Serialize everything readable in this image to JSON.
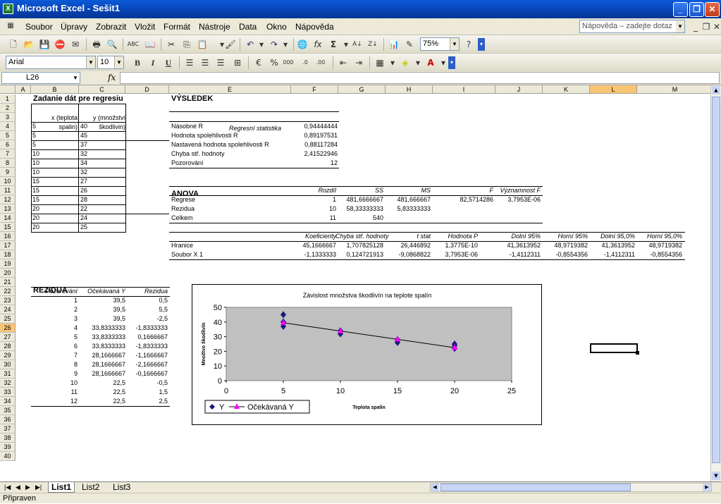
{
  "window": {
    "title": "Microsoft Excel - Sešit1"
  },
  "menu": {
    "items": [
      "Soubor",
      "Úpravy",
      "Zobrazit",
      "Vložit",
      "Formát",
      "Nástroje",
      "Data",
      "Okno",
      "Nápověda"
    ],
    "help_placeholder": "Nápověda – zadejte dotaz"
  },
  "toolbar": {
    "zoom": "75%",
    "font": "Arial",
    "size": "10",
    "bold": "B",
    "italic": "I",
    "underline": "U"
  },
  "formula_bar": {
    "name_box": "L26",
    "fx": "fx",
    "formula": ""
  },
  "columns": [
    "A",
    "B",
    "C",
    "D",
    "E",
    "F",
    "G",
    "H",
    "I",
    "J",
    "K",
    "L",
    "M"
  ],
  "rows": [
    "1",
    "2",
    "3",
    "4",
    "5",
    "6",
    "7",
    "8",
    "9",
    "10",
    "11",
    "12",
    "13",
    "14",
    "15",
    "16",
    "17",
    "18",
    "19",
    "20",
    "21",
    "22",
    "23",
    "24",
    "25",
    "26",
    "27",
    "28",
    "29",
    "30",
    "31",
    "32",
    "33",
    "34",
    "35",
    "36",
    "37",
    "38",
    "39",
    "40"
  ],
  "input_table": {
    "title": "Zadanie dát pre regresiu",
    "hdr_x1": "x (teplota",
    "hdr_x2": "spalin)",
    "hdr_y1": "y (množství",
    "hdr_y2": "škodlivin)",
    "rows": [
      [
        "5",
        "40"
      ],
      [
        "5",
        "45"
      ],
      [
        "5",
        "37"
      ],
      [
        "10",
        "32"
      ],
      [
        "10",
        "34"
      ],
      [
        "10",
        "32"
      ],
      [
        "15",
        "27"
      ],
      [
        "15",
        "26"
      ],
      [
        "15",
        "28"
      ],
      [
        "20",
        "22"
      ],
      [
        "20",
        "24"
      ],
      [
        "20",
        "25"
      ]
    ]
  },
  "summary": {
    "title": "VÝSLEDEK",
    "regress_header": "Regresní statistika",
    "stats": [
      [
        "Násobné R",
        "0,94444444"
      ],
      [
        "Hodnota spolehlivosti R",
        "0,89197531"
      ],
      [
        "Nastavená hodnota spolehlivosti R",
        "0,88117284"
      ],
      [
        "Chyba stř. hodnoty",
        "2,41522946"
      ],
      [
        "Pozorování",
        "12"
      ]
    ],
    "anova_title": "ANOVA",
    "anova_headers": [
      "Rozdíl",
      "SS",
      "MS",
      "F",
      "Významnost F"
    ],
    "anova_rows": [
      [
        "Regrese",
        "1",
        "481,6666667",
        "481,666667",
        "82,5714286",
        "3,7953E-06"
      ],
      [
        "Rezidua",
        "10",
        "58,33333333",
        "5,83333333",
        "",
        ""
      ],
      [
        "Celkem",
        "11",
        "540",
        "",
        "",
        ""
      ]
    ],
    "coef_headers": [
      "Koeficienty",
      "Chyba stř. hodnoty",
      "t stat",
      "Hodnota P",
      "Dolní 95%",
      "Horní 95%",
      "Dolní 95,0%",
      "Horní 95,0%"
    ],
    "coef_rows": [
      [
        "Hranice",
        "45,1666667",
        "1,707825128",
        "26,446892",
        "1,3775E-10",
        "41,3613952",
        "48,9719382",
        "41,3613952",
        "48,9719382"
      ],
      [
        "Soubor X 1",
        "-1,1333333",
        "0,124721913",
        "-9,0868822",
        "3,7953E-06",
        "-1,4112311",
        "-0,8554356",
        "-1,4112311",
        "-0,8554356"
      ]
    ]
  },
  "residuals": {
    "title": "REZIDUA",
    "headers": [
      "Pozorování",
      "Očekávaná Y",
      "Rezidua"
    ],
    "rows": [
      [
        "1",
        "39,5",
        "0,5"
      ],
      [
        "2",
        "39,5",
        "5,5"
      ],
      [
        "3",
        "39,5",
        "-2,5"
      ],
      [
        "4",
        "33,8333333",
        "-1,8333333"
      ],
      [
        "5",
        "33,8333333",
        "0,1666667"
      ],
      [
        "6",
        "33,8333333",
        "-1,8333333"
      ],
      [
        "7",
        "28,1666667",
        "-1,1666667"
      ],
      [
        "8",
        "28,1666667",
        "-2,1666667"
      ],
      [
        "9",
        "28,1666667",
        "-0,1666667"
      ],
      [
        "10",
        "22,5",
        "-0,5"
      ],
      [
        "11",
        "22,5",
        "1,5"
      ],
      [
        "12",
        "22,5",
        "2,5"
      ]
    ]
  },
  "chart_data": {
    "type": "scatter",
    "title": "Závislost množstva škodlivín na teplote spalín",
    "xlabel": "Teplota spalín",
    "ylabel": "Množtvo škodlivín",
    "xlim": [
      0,
      25
    ],
    "ylim": [
      0,
      50
    ],
    "xticks": [
      "0",
      "5",
      "10",
      "15",
      "20",
      "25"
    ],
    "yticks": [
      "0",
      "10",
      "20",
      "30",
      "40",
      "50"
    ],
    "legend": "bottom-left",
    "series": [
      {
        "name": "Y",
        "color": "#1a1a80",
        "x": [
          5,
          5,
          5,
          10,
          10,
          10,
          15,
          15,
          15,
          20,
          20,
          20
        ],
        "y": [
          40,
          45,
          37,
          32,
          34,
          32,
          27,
          26,
          28,
          22,
          24,
          25
        ]
      },
      {
        "name": "Očekávaná Y",
        "color": "#ff00ff",
        "x": [
          5,
          10,
          15,
          20
        ],
        "y": [
          39.5,
          33.8333333,
          28.1666667,
          22.5
        ]
      }
    ]
  },
  "sheet_tabs": [
    "List1",
    "List2",
    "List3"
  ],
  "status": "Připraven"
}
